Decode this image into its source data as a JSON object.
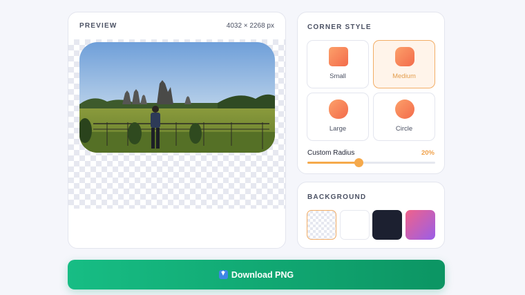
{
  "preview": {
    "title": "PREVIEW",
    "dimensions": "4032 × 2268 px"
  },
  "corner_style": {
    "title": "CORNER STYLE",
    "options": [
      {
        "label": "Small",
        "selected": false
      },
      {
        "label": "Medium",
        "selected": true
      },
      {
        "label": "Large",
        "selected": false
      },
      {
        "label": "Circle",
        "selected": false
      }
    ],
    "custom_radius_label": "Custom Radius",
    "custom_radius_value": "20%",
    "custom_radius_fraction": 0.4
  },
  "background": {
    "title": "BACKGROUND",
    "swatches": [
      {
        "name": "transparent",
        "selected": true
      },
      {
        "name": "white",
        "color": "#ffffff",
        "selected": false
      },
      {
        "name": "dark",
        "color": "#1c2030",
        "selected": false
      },
      {
        "name": "gradient",
        "color": "#f0628a",
        "selected": false
      }
    ]
  },
  "download": {
    "label": "Download PNG",
    "icon": "download-arrow-icon"
  },
  "colors": {
    "accent": "#f5a94b",
    "download": "#12a872"
  }
}
